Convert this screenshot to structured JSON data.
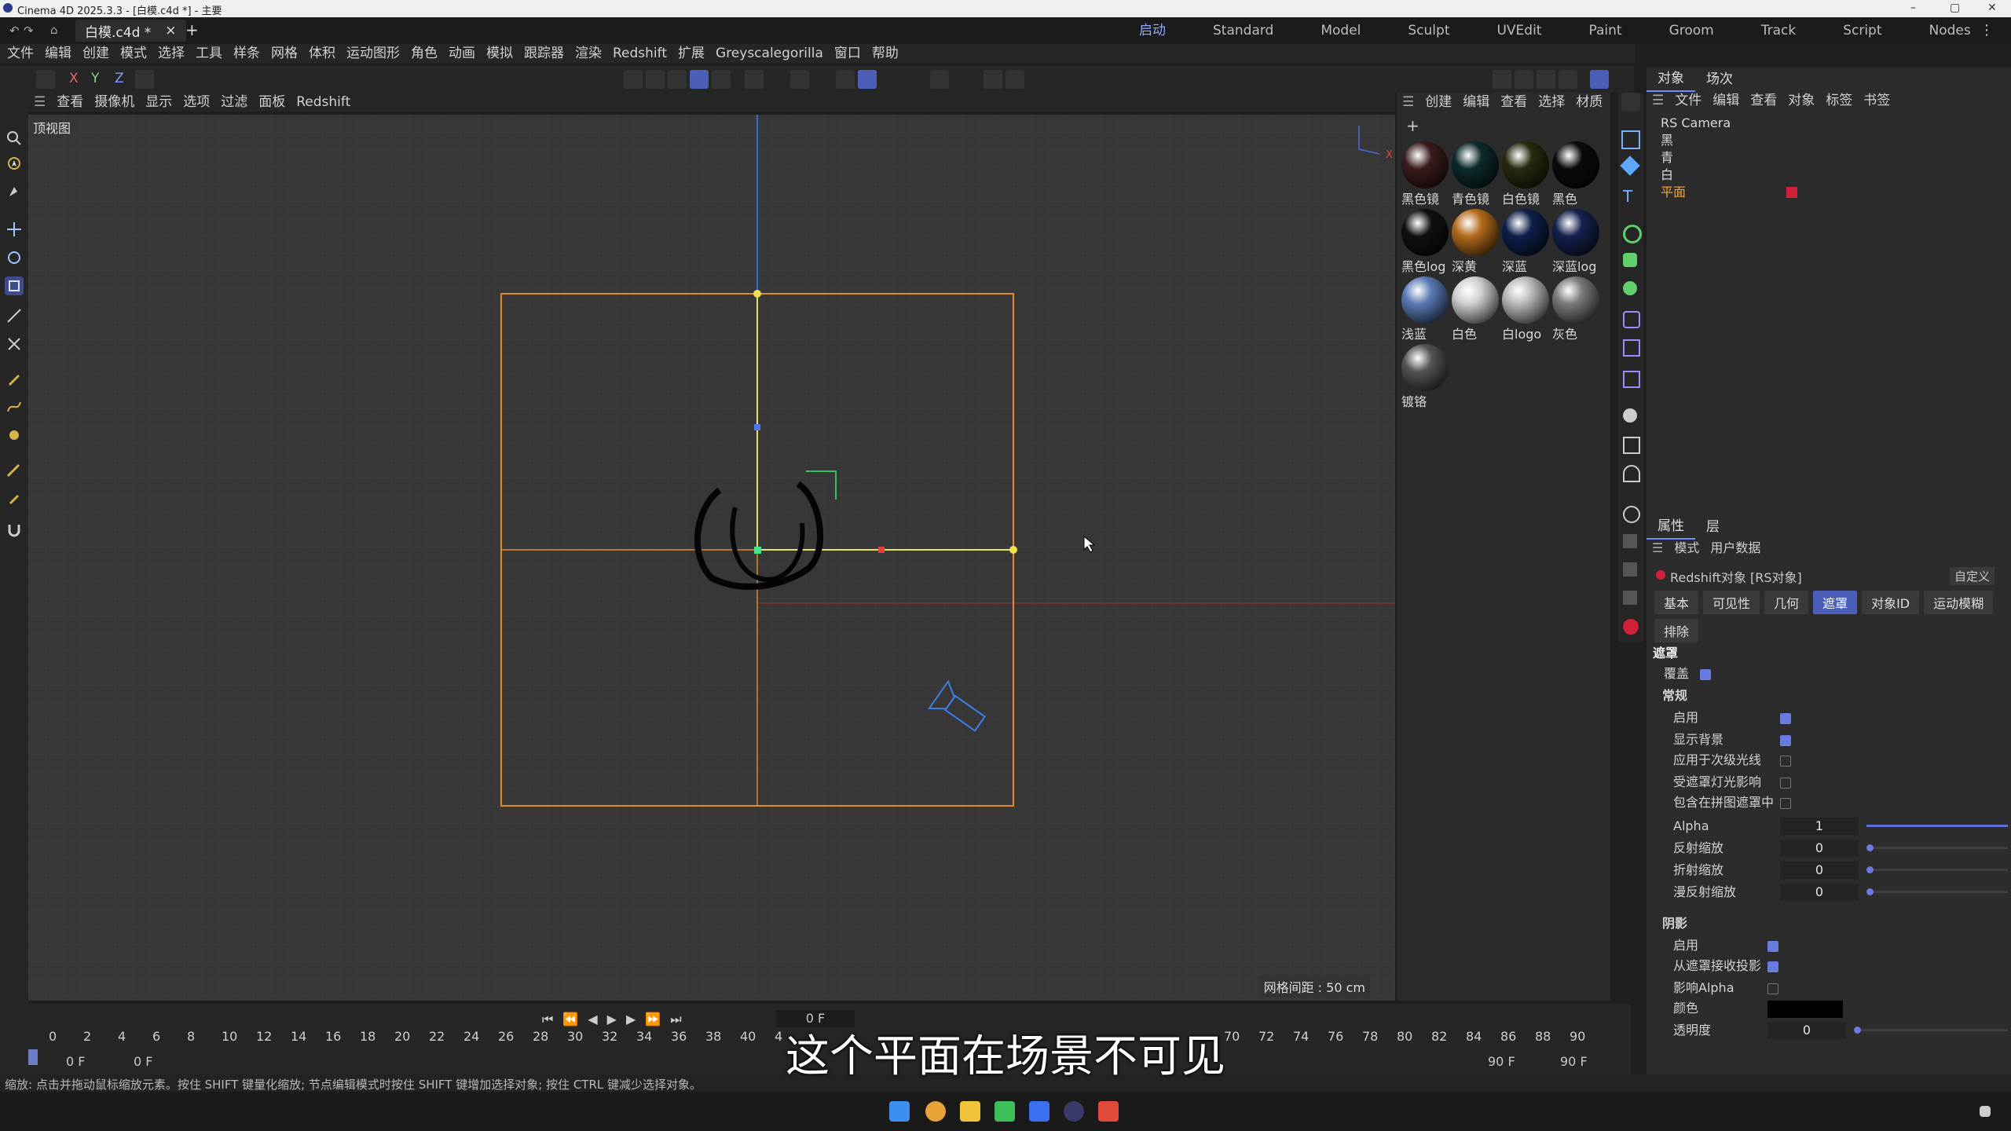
{
  "window": {
    "title": "Cinema 4D 2025.3.3 - [白模.c4d *] - 主要",
    "min": "–",
    "max": "▢",
    "close": "✕"
  },
  "doc_tab": {
    "label": "白模.c4d *",
    "close": "×",
    "add": "+"
  },
  "layout_tabs": [
    "启动",
    "Standard",
    "Model",
    "Sculpt",
    "UVEdit",
    "Paint",
    "Groom",
    "Track",
    "Script",
    "Nodes"
  ],
  "menu": [
    "文件",
    "编辑",
    "创建",
    "模式",
    "选择",
    "工具",
    "样条",
    "网格",
    "体积",
    "运动图形",
    "角色",
    "动画",
    "模拟",
    "跟踪器",
    "渲染",
    "Redshift",
    "扩展",
    "Greyscalegorilla",
    "窗口",
    "帮助"
  ],
  "axis_toggles": [
    "X",
    "Y",
    "Z"
  ],
  "viewport_menu": [
    "查看",
    "摄像机",
    "显示",
    "选项",
    "过滤",
    "面板",
    "Redshift"
  ],
  "viewport": {
    "label": "顶视图",
    "grid_info": "网格间距 : 50 cm"
  },
  "material_menu": [
    "创建",
    "编辑",
    "查看",
    "选择",
    "材质"
  ],
  "materials": [
    {
      "name": "黑色镜",
      "color": "#3a1c1c"
    },
    {
      "name": "青色镜",
      "color": "#0e2a2a"
    },
    {
      "name": "白色镜",
      "color": "#2a2a10"
    },
    {
      "name": "黑色",
      "color": "#0b0b0b"
    },
    {
      "name": "黑色log",
      "color": "#111"
    },
    {
      "name": "深黄",
      "color": "#b36a1a"
    },
    {
      "name": "深蓝",
      "color": "#0f1f4a"
    },
    {
      "name": "深蓝log",
      "color": "#14214e"
    },
    {
      "name": "浅蓝",
      "color": "#5a7ab5"
    },
    {
      "name": "白色",
      "color": "#cfcfcf"
    },
    {
      "name": "白logo",
      "color": "#b9b9b9"
    },
    {
      "name": "灰色",
      "color": "#7a7a7a"
    },
    {
      "name": "镀铬",
      "color": "#555"
    }
  ],
  "object_panel": {
    "tabs": [
      "对象",
      "场次"
    ],
    "menu": [
      "文件",
      "编辑",
      "查看",
      "对象",
      "标签",
      "书签"
    ],
    "objects": [
      "RS Camera",
      "黑",
      "青",
      "白",
      "平面"
    ]
  },
  "attr_panel": {
    "tabs": [
      "属性",
      "层"
    ],
    "menu": [
      "模式",
      "用户数据"
    ],
    "object_title": "Redshift对象 [RS对象]",
    "preset": "自定义",
    "sub_tabs": [
      "基本",
      "可见性",
      "几何",
      "遮罩",
      "对象ID",
      "运动模糊",
      "排除"
    ],
    "section": "遮罩",
    "override": "覆盖",
    "group_normal": "常规",
    "props_normal": [
      "启用",
      "显示背景",
      "应用于次级光线",
      "受遮罩灯光影响",
      "包含在拼图遮罩中"
    ],
    "props_numeric": [
      {
        "label": "Alpha",
        "value": "1"
      },
      {
        "label": "反射缩放",
        "value": "0"
      },
      {
        "label": "折射缩放",
        "value": "0"
      },
      {
        "label": "漫反射缩放",
        "value": "0"
      }
    ],
    "group_shadow": "阴影",
    "props_shadow": [
      "启用",
      "从遮罩接收投影",
      "影响Alpha",
      "颜色",
      "透明度"
    ],
    "transparency_value": "0"
  },
  "timeline": {
    "current": "0 F",
    "start": "0 F",
    "start2": "0 F",
    "end": "90 F",
    "end2": "90 F",
    "ticks": [
      "0",
      "2",
      "4",
      "6",
      "8",
      "10",
      "12",
      "14",
      "16",
      "18",
      "20",
      "22",
      "24",
      "26",
      "28",
      "30",
      "32",
      "34",
      "36",
      "38",
      "40",
      "4",
      "",
      "",
      "",
      "",
      "",
      "",
      "",
      "",
      "",
      "",
      "",
      "",
      "70",
      "72",
      "74",
      "76",
      "78",
      "80",
      "82",
      "84",
      "86",
      "88",
      "90"
    ]
  },
  "status": "缩放: 点击并拖动鼠标缩放元素。按住 SHIFT 键量化缩放; 节点编辑模式时按住 SHIFT 键增加选择对象; 按住 CTRL 键减少选择对象。",
  "subtitle": "这个平面在场景不可见",
  "colors": {
    "accent": "#4b5fb8",
    "selection": "#e08a2c"
  }
}
